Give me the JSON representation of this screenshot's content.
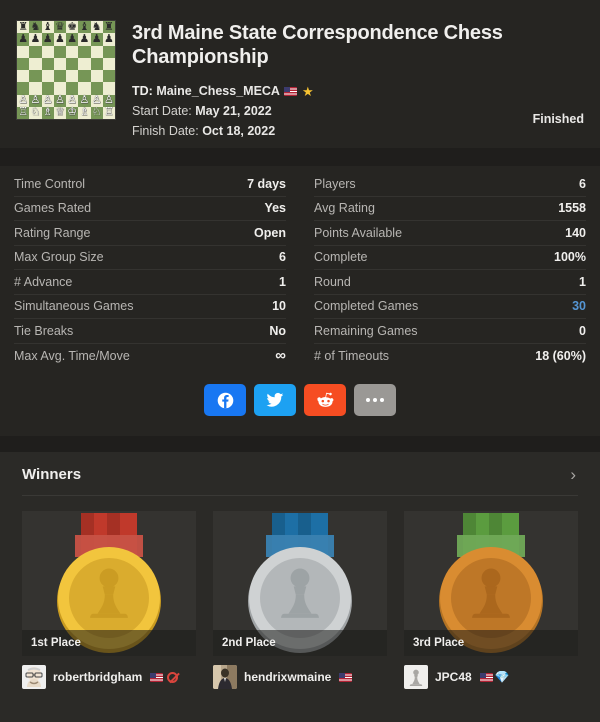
{
  "header": {
    "board_icon": "chess-board-start-position",
    "title": "3rd Maine State Correspondence Chess Championship",
    "td_label": "TD:",
    "td_name": "Maine_Chess_MECA",
    "td_flag": "flag-us-icon",
    "td_star": "star-icon",
    "start_date_label": "Start Date:",
    "start_date": "May 21, 2022",
    "finish_date_label": "Finish Date:",
    "finish_date": "Oct 18, 2022",
    "status": "Finished"
  },
  "stats": {
    "left": [
      {
        "label": "Time Control",
        "value": "7 days"
      },
      {
        "label": "Games Rated",
        "value": "Yes"
      },
      {
        "label": "Rating Range",
        "value": "Open"
      },
      {
        "label": "Max Group Size",
        "value": "6"
      },
      {
        "label": "# Advance",
        "value": "1"
      },
      {
        "label": "Simultaneous Games",
        "value": "10"
      },
      {
        "label": "Tie Breaks",
        "value": "No"
      },
      {
        "label": "Max Avg. Time/Move",
        "value": "∞"
      }
    ],
    "right": [
      {
        "label": "Players",
        "value": "6"
      },
      {
        "label": "Avg Rating",
        "value": "1558"
      },
      {
        "label": "Points Available",
        "value": "140"
      },
      {
        "label": "Complete",
        "value": "100%"
      },
      {
        "label": "Round",
        "value": "1"
      },
      {
        "label": "Completed Games",
        "value": "30",
        "link": true
      },
      {
        "label": "Remaining Games",
        "value": "0"
      },
      {
        "label": "# of Timeouts",
        "value": "18 (60%)"
      }
    ]
  },
  "share": {
    "buttons": [
      {
        "name": "facebook-share-button",
        "icon": "facebook-icon",
        "color": "#1877f2"
      },
      {
        "name": "twitter-share-button",
        "icon": "twitter-icon",
        "color": "#1da1f2"
      },
      {
        "name": "reddit-share-button",
        "icon": "reddit-icon",
        "color": "#f64d22"
      },
      {
        "name": "more-share-button",
        "icon": "ellipsis-icon",
        "color": "#9a9895"
      }
    ]
  },
  "winners": {
    "title": "Winners",
    "chevron": "chevron-right-icon",
    "cards": [
      {
        "place": "1st Place",
        "medal": "gold-medal-pawn-icon",
        "ribbon_color": "#c0392b",
        "medal_color": "#f2c53d",
        "player": "robertbridgham",
        "flag": "flag-us-icon",
        "badge": "closed-account-icon"
      },
      {
        "place": "2nd Place",
        "medal": "silver-medal-pawn-icon",
        "ribbon_color": "#1d6fa5",
        "medal_color": "#cfd2d3",
        "player": "hendrixwmaine",
        "flag": "flag-us-icon",
        "badge": ""
      },
      {
        "place": "3rd Place",
        "medal": "bronze-medal-pawn-icon",
        "ribbon_color": "#5b9c3f",
        "medal_color": "#d98c31",
        "player": "JPC48",
        "flag": "flag-us-icon",
        "badge": "diamond-member-icon"
      }
    ]
  }
}
